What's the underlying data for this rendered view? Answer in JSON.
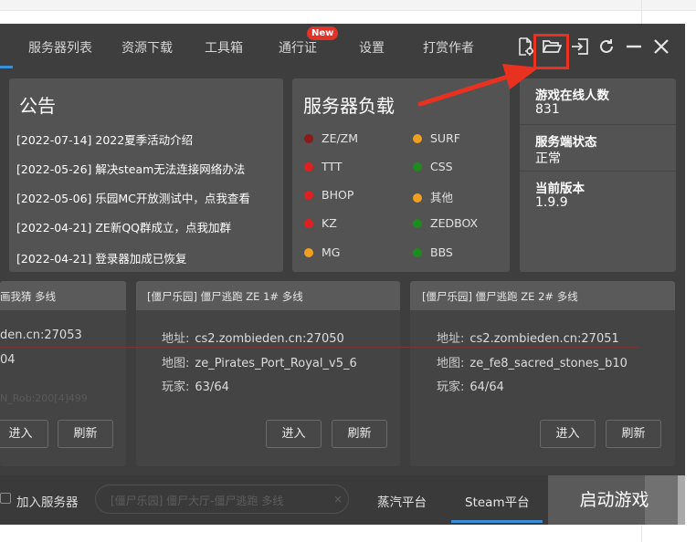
{
  "nav": {
    "tabs": [
      "服务器列表",
      "资源下载",
      "工具箱",
      "通行证",
      "设置",
      "打赏作者"
    ],
    "new_badge": "New",
    "window_buttons": [
      "settings-file-icon",
      "folder-open-icon",
      "login-icon",
      "refresh-icon",
      "minimize-icon",
      "close-icon"
    ]
  },
  "announcement": {
    "title": "公告",
    "items": [
      "[2022-07-14] 2022夏季活动介绍",
      "[2022-05-26] 解决steam无法连接网络办法",
      "[2022-05-06] 乐园MC开放测试中，点我查看",
      "[2022-04-21] ZE新QQ群成立，点我加群",
      "[2022-04-21] 登录器加成已恢复"
    ]
  },
  "server_load": {
    "title": "服务器负载",
    "items": [
      {
        "label": "ZE/ZM",
        "color": "#8b1a1a"
      },
      {
        "label": "SURF",
        "color": "#f0a020"
      },
      {
        "label": "TTT",
        "color": "#e02020"
      },
      {
        "label": "CSS",
        "color": "#1f8a1f"
      },
      {
        "label": "BHOP",
        "color": "#e02020"
      },
      {
        "label": "其他",
        "color": "#f0a020"
      },
      {
        "label": "KZ",
        "color": "#e02020"
      },
      {
        "label": "ZEDBOX",
        "color": "#1f8a1f"
      },
      {
        "label": "MG",
        "color": "#f0a020"
      },
      {
        "label": "BBS",
        "color": "#1f8a1f"
      }
    ]
  },
  "stats": {
    "online_label": "游戏在线人数",
    "online_value": "831",
    "status_label": "服务端状态",
    "status_value": "正常",
    "version_label": "当前版本",
    "version_value": "1.9.9"
  },
  "servers": [
    {
      "title": "画我猜 多线",
      "address": "den.cn:27053",
      "map": "04",
      "faint": "N_Rob:200[4]499",
      "join": "进入",
      "refresh": "刷新"
    },
    {
      "title": "[僵尸乐园] 僵尸逃跑 ZE 1# 多线",
      "address_label": "地址:",
      "address": "cs2.zombieden.cn:27050",
      "map_label": "地图:",
      "map": "ze_Pirates_Port_Royal_v5_6",
      "players_label": "玩家:",
      "players": "63/64",
      "join": "进入",
      "refresh": "刷新"
    },
    {
      "title": "[僵尸乐园] 僵尸逃跑 ZE 2# 多线",
      "address_label": "地址:",
      "address": "cs2.zombieden.cn:27051",
      "map_label": "地图:",
      "map": "ze_fe8_sacred_stones_b10",
      "players_label": "玩家:",
      "players": "64/64",
      "join": "进入",
      "refresh": "刷新"
    }
  ],
  "bottom": {
    "add_server_label": "加入服务器",
    "server_select": "[僵尸乐园] 僵尸大厅-僵尸逃跑 多线",
    "clear": "×",
    "platforms": [
      "蒸汽平台",
      "Steam平台"
    ],
    "launch": "启动游戏"
  },
  "colors": {
    "accent": "#3a8fd9",
    "highlight": "#e8321f",
    "window_bg": "#3e3e3e",
    "card_bg": "#535353"
  }
}
